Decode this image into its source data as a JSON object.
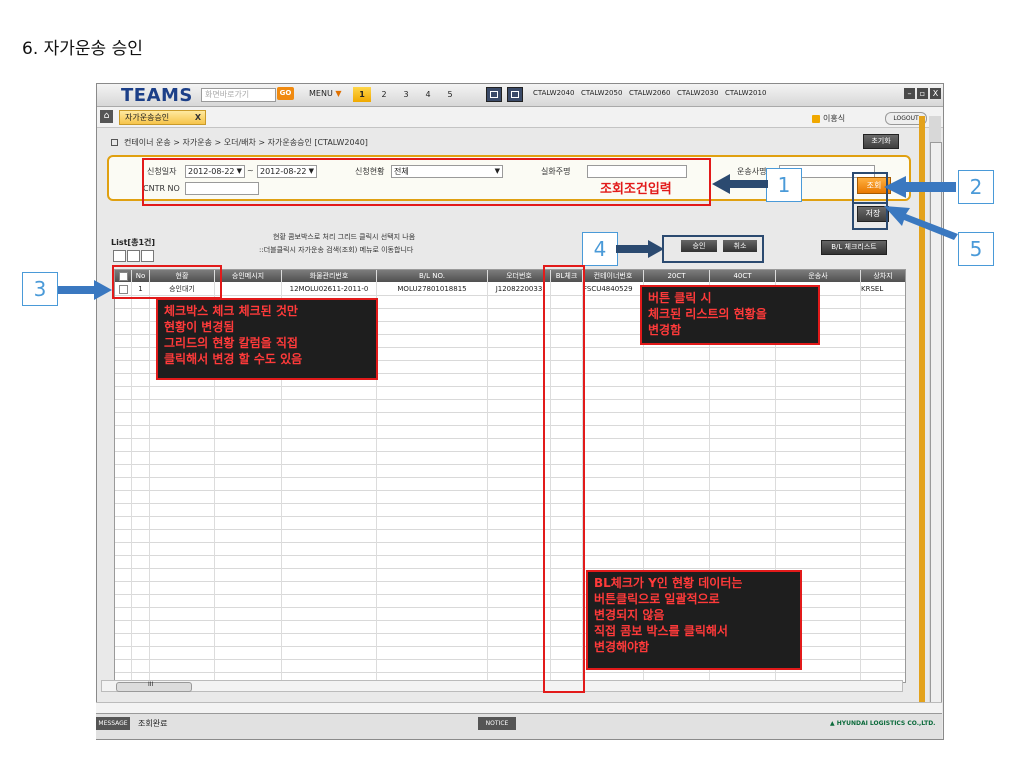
{
  "doc": {
    "heading": "6. 자가운송 승인"
  },
  "app": {
    "logo": "TEAMS",
    "quick_search_placeholder": "화면바로가기",
    "go_label": "GO",
    "menu_label": "MENU",
    "menu_caret": "▼",
    "workspace_tabs": [
      "1",
      "2",
      "3",
      "4",
      "5"
    ],
    "shortcuts": [
      "CTALW2040",
      "CTALW2050",
      "CTALW2060",
      "CTALW2030",
      "CTALW2010"
    ],
    "window_controls": [
      "–",
      "▫",
      "X"
    ],
    "open_tab": "자가운송승인",
    "open_tab_close": "X",
    "home_icon": "⌂",
    "user_name": "이홍식",
    "logout_label": "LOGOUT"
  },
  "page": {
    "breadcrumb": "컨테이너 운송 > 자가운송 > 오더/배차 > 자가운송승인 [CTALW2040]",
    "reset_label": "초기화"
  },
  "search": {
    "date_label": "신청일자",
    "date_from": "2012-08-22",
    "date_sep": "~",
    "date_to": "2012-08-22",
    "status_label": "신청현황",
    "status_value": "전체",
    "shipper_label": "실화주명",
    "shipper_value": "",
    "carrier_label": "운송사명",
    "carrier_value": "",
    "cntr_label": "CNTR NO",
    "cntr_value": "",
    "inquire_label": "조회",
    "save_label": "저장"
  },
  "list": {
    "title": "List[총1건]",
    "note1": "현황 콤보박스로 처리 그리드 클릭시 선택지 나옴",
    "note2": "::더블클릭시 자가운송 검색(조회) 메뉴로 이동합니다",
    "approve_label": "승인",
    "cancel_label": "취소",
    "blcheck_label": "B/L 체크리스트"
  },
  "grid": {
    "columns": [
      "No",
      "현황",
      "승인메시지",
      "화물관리번호",
      "B/L NO.",
      "오더번호",
      "BL체크",
      "컨테이너번호",
      "20CT",
      "40CT",
      "운송사",
      "상차지"
    ],
    "rows": [
      [
        "1",
        "승인대기",
        "",
        "12MOLU02611-2011-0",
        "MOLU27801018815",
        "J1208220033",
        "",
        "FSCU4840529",
        "",
        "",
        "",
        "KRSEL"
      ]
    ],
    "scroll_grip": "III"
  },
  "status": {
    "message_tag": "MESSAGE",
    "message_text": "조회완료",
    "notice_tag": "NOTICE",
    "company": "▲ HYUNDAI LOGISTICS CO.,LTD."
  },
  "annotations": {
    "search_caption": "조회조건입력",
    "markers": [
      "1",
      "2",
      "3",
      "4",
      "5"
    ],
    "note_checkbox": [
      "체크박스 체크 체크된 것만",
      "현황이 변경됨",
      "그리드의 현황 칼럼을 직접",
      "클릭해서 변경 할 수도 있음"
    ],
    "note_button": [
      "버튼 클릭 시",
      "체크된 리스트의 현황을",
      "변경함"
    ],
    "note_blcheck": [
      "BL체크가 Y인 현황 데이터는",
      "버튼클릭으로 일괄적으로",
      "변경되지 않음",
      "직접 콤보 박스를 클릭해서",
      "변경해야함"
    ]
  }
}
